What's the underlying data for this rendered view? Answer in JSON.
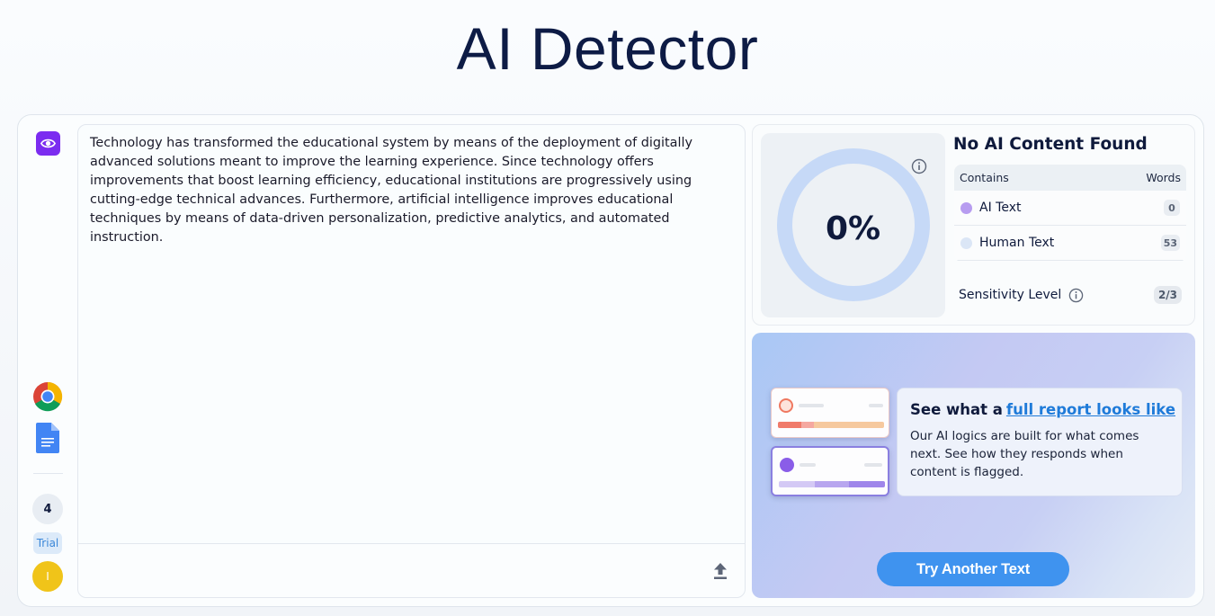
{
  "page": {
    "title": "AI Detector"
  },
  "sidebar": {
    "usage_count": "4",
    "plan_label": "Trial",
    "avatar_initial": "I"
  },
  "editor": {
    "text": "Technology has transformed the educational system by means of the deployment of digitally advanced solutions meant to improve the learning experience. Since technology offers improvements that boost learning efficiency, educational institutions are progressively using cutting-edge technical advances. Furthermore, artificial intelligence improves educational techniques by means of data-driven personalization, predictive analytics, and automated instruction."
  },
  "result": {
    "percentage": "0%",
    "title": "No AI Content Found",
    "table": {
      "col_contains": "Contains",
      "col_words": "Words",
      "rows": [
        {
          "label": "AI Text",
          "count": "0",
          "color": "#b79cf0"
        },
        {
          "label": "Human Text",
          "count": "53",
          "color": "#dbe6f6"
        }
      ]
    },
    "sensitivity": {
      "label": "Sensitivity Level",
      "value": "2/3"
    }
  },
  "promo": {
    "heading_prefix": "See what a",
    "heading_link": "full report looks like",
    "body": "Our AI logics are built for what comes next. See how they responds when content is flagged.",
    "button_label": "Try Another Text"
  },
  "colors": {
    "accent": "#3f93ef",
    "gauge_ring": "#c6d9f7",
    "brand_purple": "#7b2cf0"
  }
}
